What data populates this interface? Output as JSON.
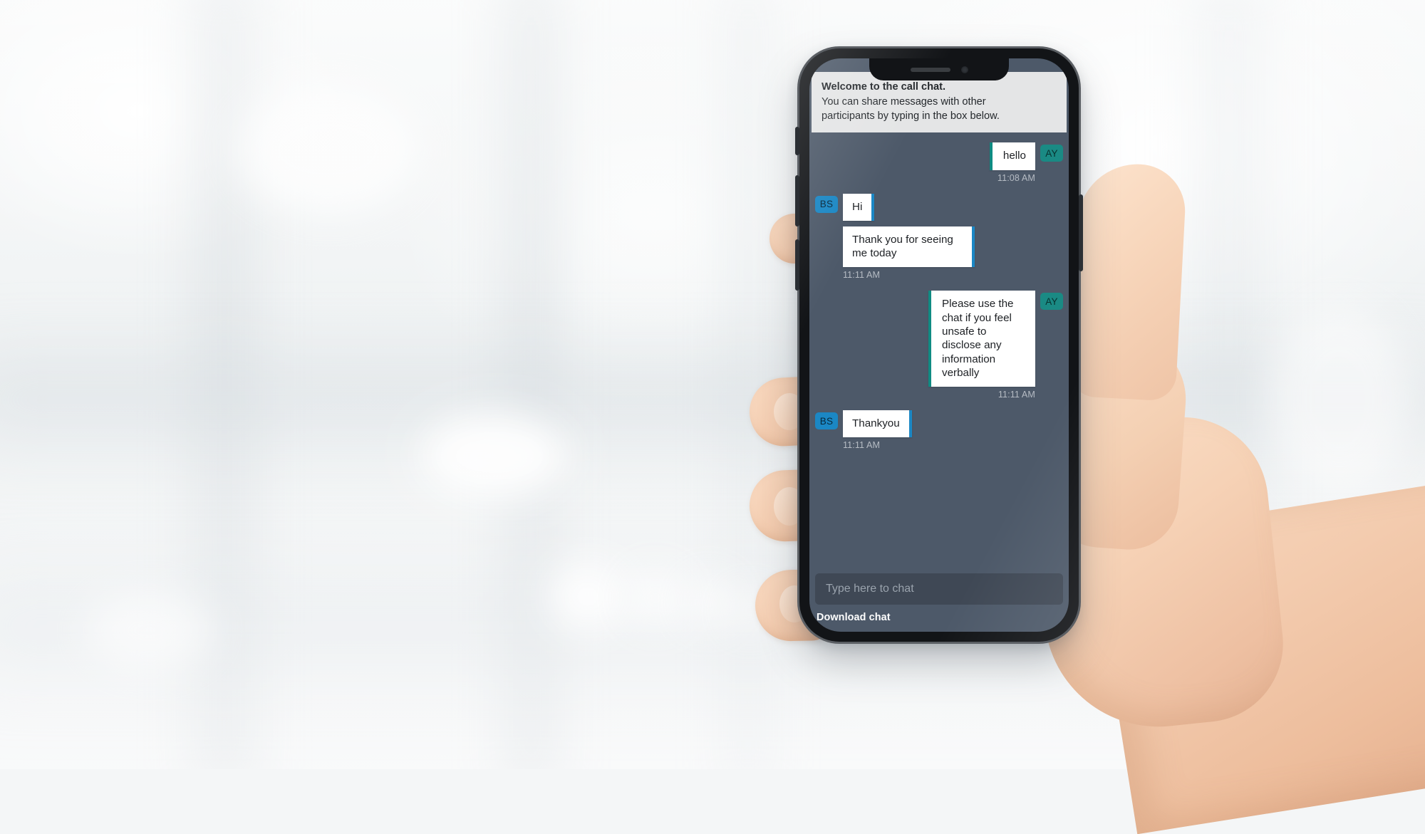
{
  "background": {
    "description": "blurred bright clinic interior",
    "hand_present": true
  },
  "device": {
    "frame_color": "#121417",
    "notch": {
      "speaker": "speaker-bar",
      "camera": "front-camera-dot"
    },
    "buttons": [
      "mute-switch",
      "volume-up",
      "volume-down",
      "power"
    ]
  },
  "chat": {
    "background_color": "#4d5969",
    "banner": {
      "title": "Welcome to the call chat.",
      "line2": "You can share messages with other",
      "line3": "participants by typing in the box below."
    },
    "messages": [
      {
        "id": "m1",
        "direction": "out",
        "avatar": "AY",
        "avatar_color": "#1a8a84",
        "accent_color": "#0f8b83",
        "text": "hello",
        "time": "11:08 AM"
      },
      {
        "id": "m2",
        "direction": "in",
        "avatar": "BS",
        "avatar_color": "#1b87c4",
        "accent_color": "#1b87c4",
        "text": "Hi",
        "time": ""
      },
      {
        "id": "m3",
        "direction": "in",
        "avatar": "",
        "avatar_color": "#1b87c4",
        "accent_color": "#1b87c4",
        "text": "Thank you for seeing me today",
        "time": "11:11 AM"
      },
      {
        "id": "m4",
        "direction": "out",
        "avatar": "AY",
        "avatar_color": "#1a8a84",
        "accent_color": "#0f8b83",
        "text": "Please use the chat if you feel unsafe to disclose any information verbally",
        "time": "11:11 AM"
      },
      {
        "id": "m5",
        "direction": "in",
        "avatar": "BS",
        "avatar_color": "#1b87c4",
        "accent_color": "#1b87c4",
        "text": "Thankyou",
        "time": "11:11 AM"
      }
    ],
    "composer": {
      "placeholder": "Type here to chat",
      "value": ""
    },
    "download_link": "Download chat"
  }
}
